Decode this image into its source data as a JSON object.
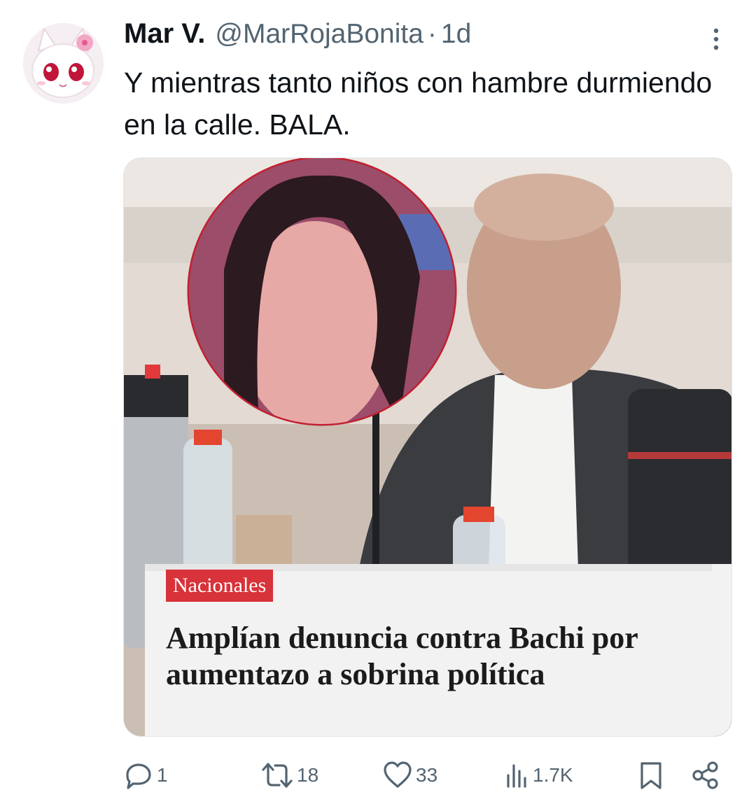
{
  "author": {
    "display_name": "Mar V.",
    "handle": "@MarRojaBonita",
    "separator": "·",
    "timestamp": "1d",
    "avatar_icon": "pink-cartoon-cat-avatar"
  },
  "tweet": {
    "text": "Y mientras tanto niños con hambre durmiendo en la calle. BALA."
  },
  "media": {
    "kicker": "Nacionales",
    "headline": "Amplían denuncia contra Bachi por aumentazo a sobrina política",
    "kicker_color": "#d8323a"
  },
  "actions": {
    "reply": {
      "icon": "reply-icon",
      "count": "1"
    },
    "retweet": {
      "icon": "retweet-icon",
      "count": "18"
    },
    "like": {
      "icon": "heart-icon",
      "count": "33"
    },
    "views": {
      "icon": "views-icon",
      "count": "1.7K"
    },
    "bookmark": {
      "icon": "bookmark-icon"
    },
    "share": {
      "icon": "share-icon"
    }
  },
  "colors": {
    "text": "#0f1419",
    "secondary": "#536471"
  }
}
